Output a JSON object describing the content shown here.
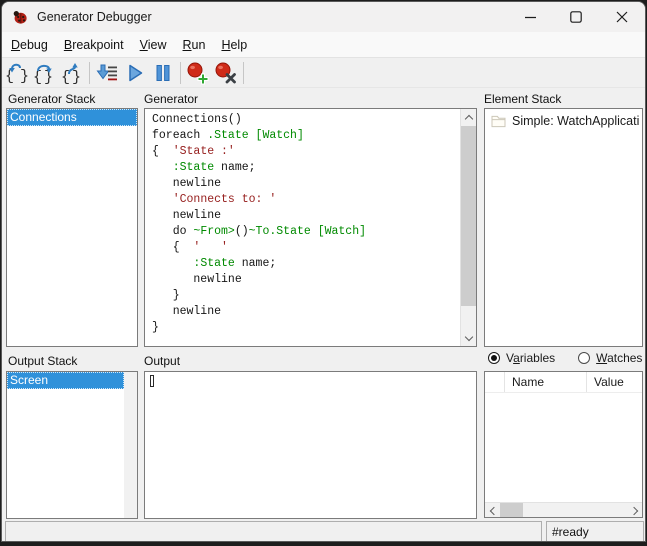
{
  "window": {
    "title": "Generator Debugger"
  },
  "menu": {
    "items": [
      "Debug",
      "Breakpoint",
      "View",
      "Run",
      "Help"
    ]
  },
  "toolbar": {
    "buttons": [
      {
        "icon": "step-into-braces-icon"
      },
      {
        "icon": "step-over-braces-icon"
      },
      {
        "icon": "step-out-braces-icon"
      },
      {
        "icon": "step-to-line-icon"
      },
      {
        "icon": "run-icon"
      },
      {
        "icon": "pause-icon"
      },
      {
        "icon": "add-breakpoint-icon"
      },
      {
        "icon": "remove-breakpoint-icon"
      }
    ]
  },
  "panels": {
    "generator_stack": {
      "label": "Generator Stack",
      "items": [
        {
          "label": "Connections",
          "selected": true
        }
      ]
    },
    "generator": {
      "label": "Generator",
      "code_lines": [
        [
          [
            "Connections()",
            "d"
          ]
        ],
        [
          [
            "foreach ",
            "d"
          ],
          [
            ".State",
            "g"
          ],
          [
            " ",
            "d"
          ],
          [
            "[Watch]",
            "g"
          ]
        ],
        [
          [
            "{  ",
            "d"
          ],
          [
            "'State :'",
            "s"
          ]
        ],
        [
          [
            "   ",
            "d"
          ],
          [
            ":State",
            "g"
          ],
          [
            " name;",
            "d"
          ]
        ],
        [
          [
            "   newline",
            "d"
          ]
        ],
        [
          [
            "   ",
            "d"
          ],
          [
            "'Connects to: '",
            "s"
          ]
        ],
        [
          [
            "   newline",
            "d"
          ]
        ],
        [
          [
            "   do ",
            "d"
          ],
          [
            "~From>",
            "g"
          ],
          [
            "()",
            "d"
          ],
          [
            "~To.State",
            "g"
          ],
          [
            " ",
            "d"
          ],
          [
            "[Watch]",
            "g"
          ]
        ],
        [
          [
            "   {  ",
            "d"
          ],
          [
            "'   '",
            "s"
          ]
        ],
        [
          [
            "      ",
            "d"
          ],
          [
            ":State",
            "g"
          ],
          [
            " name;",
            "d"
          ]
        ],
        [
          [
            "      newline",
            "d"
          ]
        ],
        [
          [
            "   }",
            "d"
          ]
        ],
        [
          [
            "   newline",
            "d"
          ]
        ],
        [
          [
            "}",
            "d"
          ]
        ]
      ]
    },
    "element_stack": {
      "label": "Element Stack",
      "items": [
        {
          "icon": "folder-icon",
          "label": "Simple: WatchApplicati"
        }
      ]
    },
    "output_stack": {
      "label": "Output Stack",
      "items": [
        {
          "label": "Screen",
          "selected": true
        }
      ]
    },
    "output": {
      "label": "Output",
      "content": ""
    },
    "variables": {
      "radio_variables": {
        "pre": "V",
        "key": "a",
        "post": "riables",
        "selected": true
      },
      "radio_watches": {
        "pre": "",
        "key": "W",
        "post": "atches",
        "selected": false
      },
      "table": {
        "columns": [
          "",
          "Name",
          "Value"
        ],
        "rows": []
      }
    }
  },
  "statusbar": {
    "message": "",
    "state": "#ready"
  },
  "colors": {
    "selection_blue": "#2f91da",
    "code_green": "#008a00",
    "code_string": "#97201f",
    "breakpoint_red": "#cf2a18"
  }
}
